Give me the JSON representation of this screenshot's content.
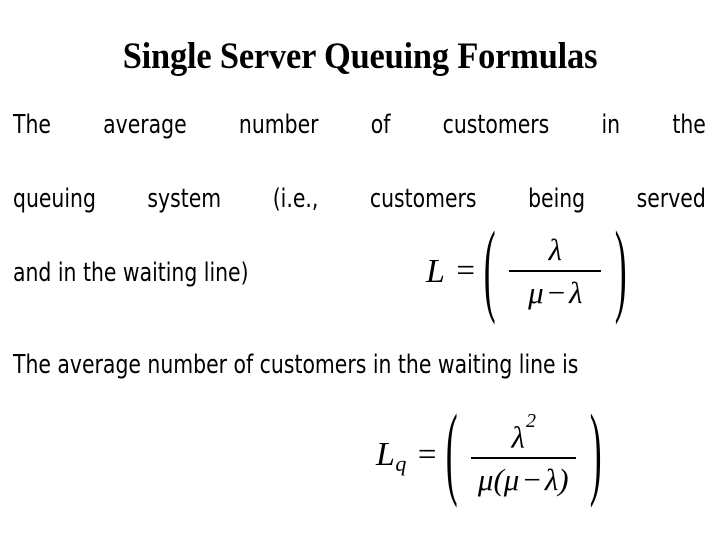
{
  "slide": {
    "title": "Single Server Queuing Formulas",
    "background_color": "#ffffff",
    "text_color": "#000000"
  },
  "paragraph_1": {
    "line_1": "The average number of customers in the",
    "line_2": "queuing system (i.e., customers being served",
    "line_3": "and in the waiting line)",
    "full_text": "The average number of customers in the queuing system (i.e., customers being served and in the waiting line)"
  },
  "paragraph_2": {
    "line_1": "The average number of customers in the waiting",
    "line_2": "line is",
    "full_text": "The average number of customers in the waiting line is"
  },
  "formula_L": {
    "lhs_symbol": "L",
    "equals": "=",
    "open_paren": "(",
    "close_paren": ")",
    "numerator": "λ",
    "denominator_first": "μ",
    "denominator_operator": "−",
    "denominator_second": "λ",
    "plain": "L = ( λ / (μ − λ) )"
  },
  "formula_Lq": {
    "lhs_symbol": "L",
    "lhs_subscript": "q",
    "equals": "=",
    "open_paren": "(",
    "close_paren": ")",
    "numerator_base": "λ",
    "numerator_exponent": "2",
    "denominator_mu": "μ",
    "denominator_inner_open": "(",
    "denominator_inner_mu": "μ",
    "denominator_operator": "−",
    "denominator_inner_lambda": "λ",
    "denominator_inner_close": ")",
    "plain": "Lq = ( λ² / (μ(μ − λ)) )"
  }
}
